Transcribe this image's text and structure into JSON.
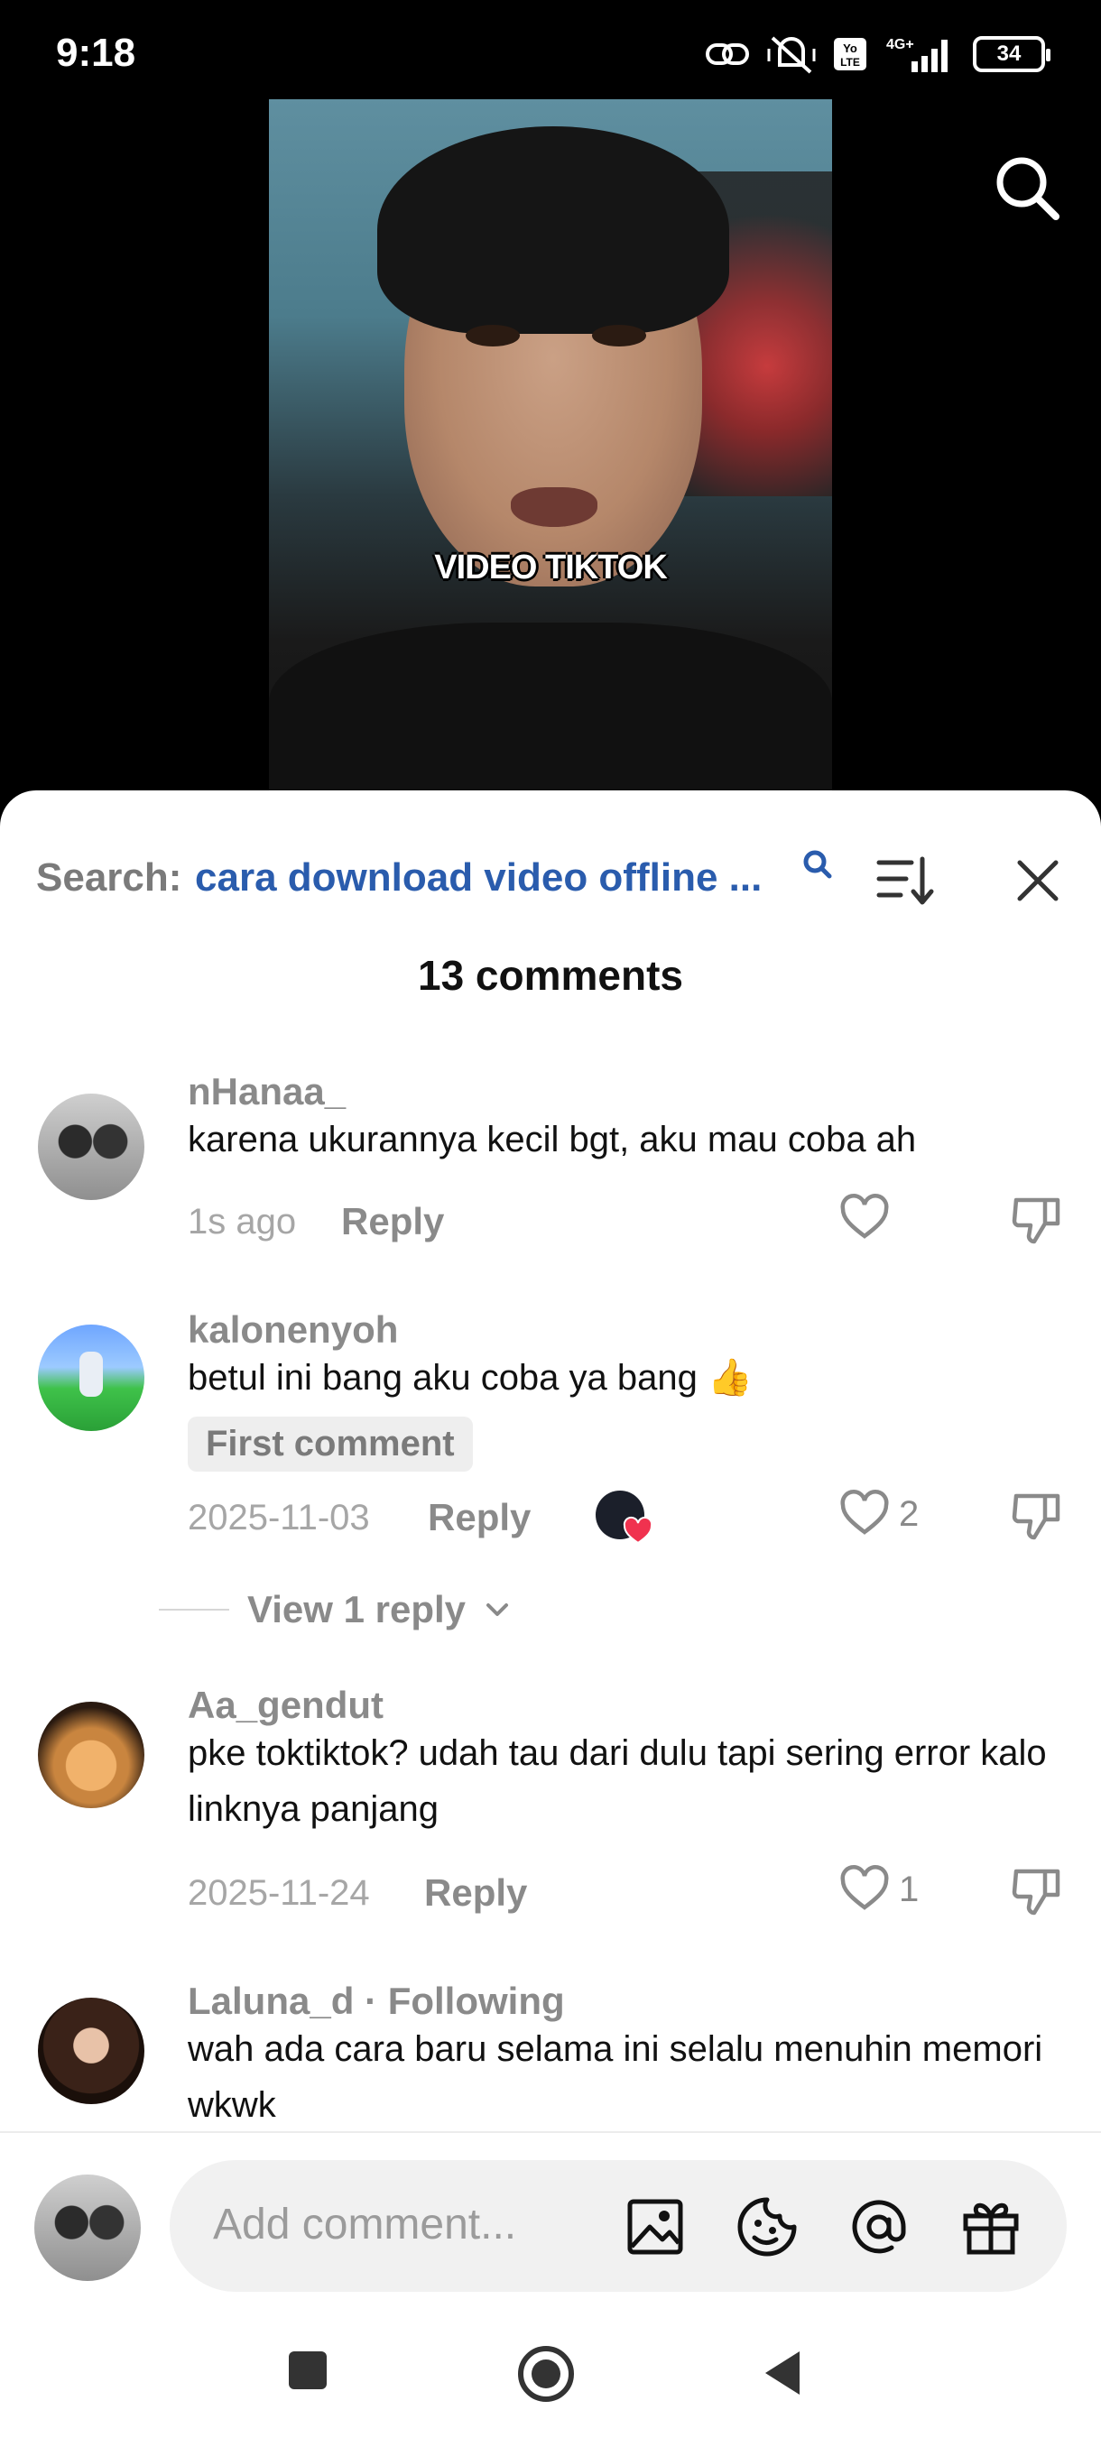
{
  "status_bar": {
    "time": "9:18",
    "battery": "34",
    "network": "4G+"
  },
  "video": {
    "caption": "VIDEO TIKTOK"
  },
  "sheet": {
    "search_label": "Search:",
    "search_query": "cara download video offline ...",
    "comment_count": "13 comments"
  },
  "comments": [
    {
      "username": "nHanaa_",
      "text": "karena ukurannya kecil bgt, aku mau coba ah",
      "time": "1s ago",
      "reply_label": "Reply",
      "likes": ""
    },
    {
      "username": "kalonenyoh",
      "text": "betul ini bang aku coba ya bang 👍",
      "badge": "First comment",
      "time": "2025-11-03",
      "reply_label": "Reply",
      "likes": "2",
      "view_replies": "View 1 reply"
    },
    {
      "username": "Aa_gendut",
      "text": "pke toktiktok? udah tau dari dulu tapi sering error kalo linknya panjang",
      "time": "2025-11-24",
      "reply_label": "Reply",
      "likes": "1"
    },
    {
      "username": "Laluna_d",
      "following": " · Following",
      "text": "wah ada cara baru selama ini selalu menuhin memori wkwk"
    }
  ],
  "input": {
    "placeholder": "Add comment..."
  },
  "colors": {
    "accent_blue": "#2a5cad",
    "muted_gray": "#8a8a8a",
    "heart_red": "#f0324f"
  }
}
